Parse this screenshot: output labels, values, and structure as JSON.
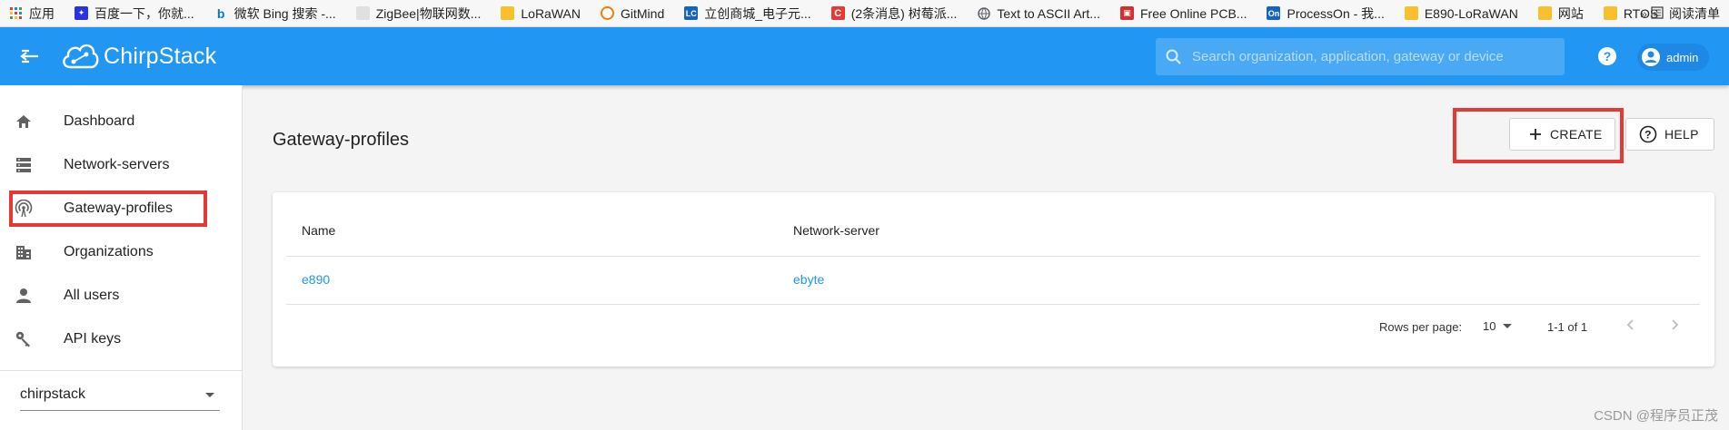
{
  "bookmarks": [
    {
      "label": "应用",
      "icon": "apps-grid-icon",
      "color": "#e53935"
    },
    {
      "label": "百度一下，你就...",
      "icon": "baidu-icon",
      "color": "#2932e1"
    },
    {
      "label": "微软 Bing 搜索 -...",
      "icon": "bing-icon",
      "color": "#0078d4"
    },
    {
      "label": "ZigBee|物联网数...",
      "icon": "page-icon",
      "color": "#9e9e9e"
    },
    {
      "label": "LoRaWAN",
      "icon": "folder-icon",
      "color": "#f9c02e"
    },
    {
      "label": "GitMind",
      "icon": "gitmind-icon",
      "color": "#f57c00"
    },
    {
      "label": "立创商城_电子元...",
      "icon": "lc-icon",
      "color": "#1565c0"
    },
    {
      "label": "(2条消息) 树莓派...",
      "icon": "csdn-icon",
      "color": "#e53935"
    },
    {
      "label": "Text to ASCII Art...",
      "icon": "globe-icon",
      "color": "#5f6368"
    },
    {
      "label": "Free Online PCB...",
      "icon": "easyeda-icon",
      "color": "#d32f2f"
    },
    {
      "label": "ProcessOn - 我...",
      "icon": "processon-icon",
      "color": "#1565c0"
    },
    {
      "label": "E890-LoRaWAN",
      "icon": "folder-icon",
      "color": "#f9c02e"
    },
    {
      "label": "网站",
      "icon": "folder-icon",
      "color": "#f9c02e"
    },
    {
      "label": "RTOS",
      "icon": "folder-icon",
      "color": "#f9c02e"
    }
  ],
  "bookmarks_more": "»",
  "reading_list": "阅读清单",
  "appbar": {
    "logo_text": "ChirpStack",
    "search_placeholder": "Search organization, application, gateway or device",
    "user_label": "admin",
    "color": "#2196f3"
  },
  "sidebar": {
    "items": [
      {
        "label": "Dashboard",
        "icon": "home-icon"
      },
      {
        "label": "Network-servers",
        "icon": "server-icon"
      },
      {
        "label": "Gateway-profiles",
        "icon": "antenna-icon"
      },
      {
        "label": "Organizations",
        "icon": "building-icon"
      },
      {
        "label": "All users",
        "icon": "person-icon"
      },
      {
        "label": "API keys",
        "icon": "key-icon"
      }
    ],
    "organization_selected": "chirpstack"
  },
  "main": {
    "title": "Gateway-profiles",
    "create_label": "CREATE",
    "help_label": "HELP",
    "table": {
      "columns": [
        "Name",
        "Network-server"
      ],
      "rows": [
        {
          "name": "e890",
          "network_server": "ebyte"
        }
      ]
    },
    "pagination": {
      "rows_per_page_label": "Rows per page:",
      "rows_per_page": "10",
      "range": "1-1 of 1"
    }
  },
  "watermark": "CSDN @程序员正茂",
  "annotation_color": "#e53935"
}
